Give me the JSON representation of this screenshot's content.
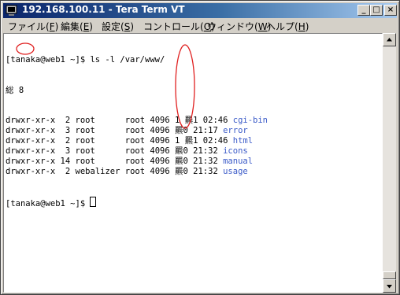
{
  "window": {
    "title": "192.168.100.11 - Tera Term VT"
  },
  "title_buttons": {
    "minimize": "_",
    "maximize": "□",
    "close": "×"
  },
  "menu": [
    {
      "label": "ファイル",
      "mnemonic": "F"
    },
    {
      "label": "編集",
      "mnemonic": "E"
    },
    {
      "label": "設定",
      "mnemonic": "S"
    },
    {
      "label": "コントロール",
      "mnemonic": "O"
    },
    {
      "label": "ウィンドウ",
      "mnemonic": "W"
    },
    {
      "label": "ヘルプ",
      "mnemonic": "H"
    }
  ],
  "terminal": {
    "prompt_cmd": "[tanaka@web1 ~]$ ls -l /var/www/",
    "total_line": "総 8",
    "entries": [
      {
        "perms": "drwxr-xr-x",
        "links": "2",
        "owner": "root",
        "group": "root",
        "size": "4096",
        "date": "1 羆1 02:46",
        "name": "cgi-bin"
      },
      {
        "perms": "drwxr-xr-x",
        "links": "3",
        "owner": "root",
        "group": "root",
        "size": "4096",
        "date": "羆0 21:17",
        "name": "error"
      },
      {
        "perms": "drwxr-xr-x",
        "links": "2",
        "owner": "root",
        "group": "root",
        "size": "4096",
        "date": "1 羆1 02:46",
        "name": "html"
      },
      {
        "perms": "drwxr-xr-x",
        "links": "3",
        "owner": "root",
        "group": "root",
        "size": "4096",
        "date": "羆0 21:32",
        "name": "icons"
      },
      {
        "perms": "drwxr-xr-x",
        "links": "14",
        "owner": "root",
        "group": "root",
        "size": "4096",
        "date": "羆0 21:32",
        "name": "manual"
      },
      {
        "perms": "drwxr-xr-x",
        "links": "2",
        "owner": "webalizer",
        "group": "root",
        "size": "4096",
        "date": "羆0 21:32",
        "name": "usage"
      }
    ],
    "final_prompt": "[tanaka@web1 ~]$ "
  },
  "colors": {
    "titlebar_start": "#0a246a",
    "titlebar_end": "#a6caf0",
    "filename_blue": "#3a5ac8",
    "annotation_red": "#e02020"
  }
}
